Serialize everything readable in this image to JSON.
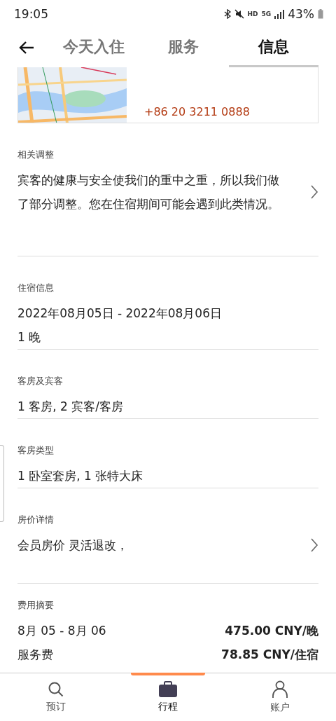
{
  "status_bar": {
    "time": "19:05",
    "hd": "HD",
    "network": "5G",
    "battery": "43%"
  },
  "tabs": [
    {
      "label": "今天入住",
      "selected": false
    },
    {
      "label": "服务",
      "selected": false
    },
    {
      "label": "信息",
      "selected": true
    }
  ],
  "map_card": {
    "phone": "+86 20 3211 0888"
  },
  "sections": [
    {
      "label": "相关调整",
      "lines": [
        "宾客的健康与安全使我们的重中之重，所以我们做了部分调整。您在住宿期间可能会遇到此类情况。"
      ],
      "chevron": true
    },
    {
      "label": "住宿信息",
      "lines": [
        "2022年08月05日 - 2022年08月06日",
        "1 晚"
      ],
      "chevron": false
    },
    {
      "label": "客房及宾客",
      "lines": [
        "1 客房, 2 宾客/客房"
      ],
      "chevron": false
    },
    {
      "label": "客房类型",
      "lines": [
        "1 卧室套房, 1 张特大床"
      ],
      "chevron": false
    },
    {
      "label": "房价详情",
      "lines": [
        "会员房价 灵活退改，"
      ],
      "chevron": true
    }
  ],
  "fees": {
    "label": "费用摘要",
    "rows": [
      {
        "name": "8月 05 - 8月 06",
        "amount": "475.00 CNY/晚"
      },
      {
        "name": "服务费",
        "amount": "78.85 CNY/住宿"
      }
    ]
  },
  "bottom_nav": [
    {
      "label": "预订",
      "selected": false
    },
    {
      "label": "行程",
      "selected": true
    },
    {
      "label": "账户",
      "selected": false
    }
  ]
}
